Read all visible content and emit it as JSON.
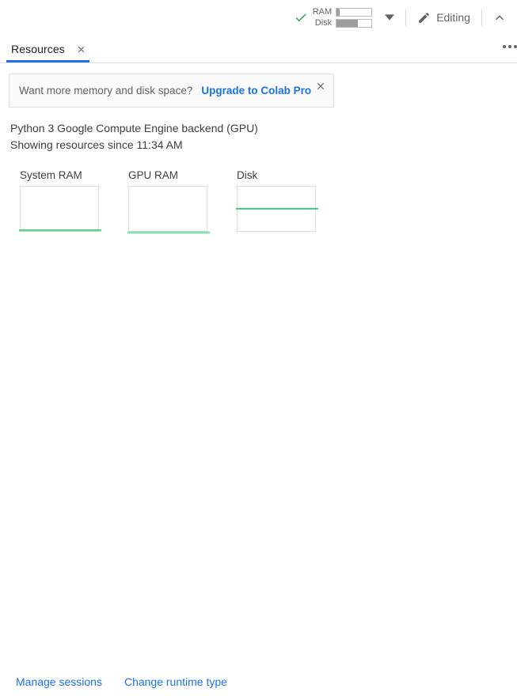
{
  "toolbar": {
    "status_icon": "green-check-icon",
    "ram_label": "RAM",
    "disk_label": "Disk",
    "ram_fill_percent": 9,
    "disk_fill_percent": 60,
    "dropdown_icon": "chevron-down-icon",
    "edit_icon": "pencil-icon",
    "edit_label": "Editing",
    "collapse_icon": "chevron-up-icon",
    "accent_color": "#1a73e8",
    "status_color": "#34a853"
  },
  "tabbar": {
    "tab_label": "Resources",
    "tab_close_icon": "close-icon",
    "overflow_icon": "more-horizontal-icon",
    "indicator_color": "#1a73e8"
  },
  "banner": {
    "text": "Want more memory and disk space?",
    "link_label": "Upgrade to Colab Pro",
    "close_icon": "close-icon"
  },
  "info": {
    "backend": "Python 3 Google Compute Engine backend (GPU)",
    "since": "Showing resources since 11:34 AM"
  },
  "charts": [
    {
      "title": "System RAM",
      "line_color": "#5fd18f",
      "value_percent": 5
    },
    {
      "title": "GPU RAM",
      "line_color": "#8ce0b0",
      "value_percent": 0
    },
    {
      "title": "Disk",
      "line_color": "#3ecb7d",
      "value_percent": 52
    }
  ],
  "chart_data": {
    "type": "line",
    "title": "Showing resources since 11:34 AM",
    "xlabel": "",
    "ylabel": "",
    "ylim": [
      0,
      100
    ],
    "grid": false,
    "legend": "none",
    "series": [
      {
        "name": "System RAM",
        "values": [
          5,
          5,
          5,
          5,
          5,
          5,
          5,
          5,
          5,
          5
        ],
        "color": "#5fd18f"
      },
      {
        "name": "GPU RAM",
        "values": [
          0,
          0,
          0,
          0,
          0,
          0,
          0,
          0,
          0,
          0
        ],
        "color": "#8ce0b0"
      },
      {
        "name": "Disk",
        "values": [
          52,
          52,
          52,
          52,
          52,
          52,
          52,
          52,
          52,
          52
        ],
        "color": "#3ecb7d"
      }
    ]
  },
  "footer": {
    "manage_sessions": "Manage sessions",
    "change_runtime": "Change runtime type"
  }
}
